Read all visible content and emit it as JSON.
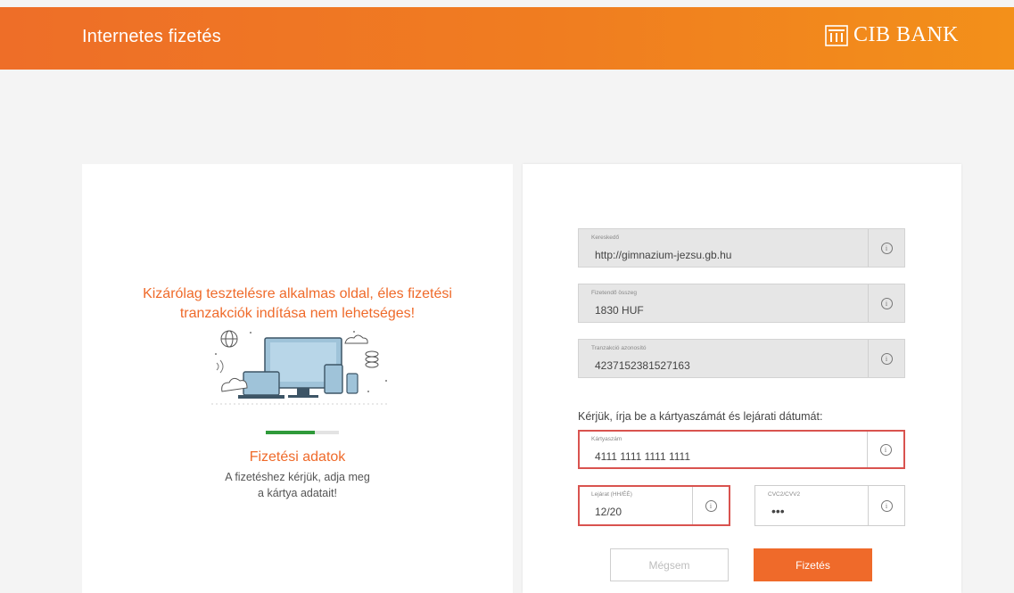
{
  "header": {
    "title": "Internetes fizetés",
    "brand": "CIB BANK"
  },
  "left": {
    "warning_line1": "Kizárólag tesztelésre alkalmas oldal, éles fizetési",
    "warning_line2": "tranzakciók indítása nem lehetséges!",
    "progress_fraction": 0.67,
    "step_title": "Fizetési adatok",
    "step_desc": "A fizetéshez kérjük, adja meg\na kártya adatait!"
  },
  "form": {
    "merchant": {
      "label": "Kereskedő",
      "value": "http://gimnazium-jezsu.gb.hu"
    },
    "amount": {
      "label": "Fizetendő összeg",
      "value": "1830 HUF"
    },
    "transaction": {
      "label": "Tranzakció azonosító",
      "value": "4237152381527163"
    },
    "prompt": "Kérjük, írja be a kártyaszámát és lejárati dátumát:",
    "card_number": {
      "label": "Kártyaszám",
      "value": "4111 1111 1111 1111"
    },
    "expiry": {
      "label": "Lejárat (HH/ÉÉ)",
      "value": "12/20"
    },
    "cvc": {
      "label": "CVC2/CVV2",
      "value": "•••"
    },
    "info_glyph": "i"
  },
  "buttons": {
    "cancel": "Mégsem",
    "pay": "Fizetés"
  },
  "colors": {
    "accent": "#ef6a2a",
    "error": "#d9534f",
    "progress": "#2f9a3a"
  }
}
